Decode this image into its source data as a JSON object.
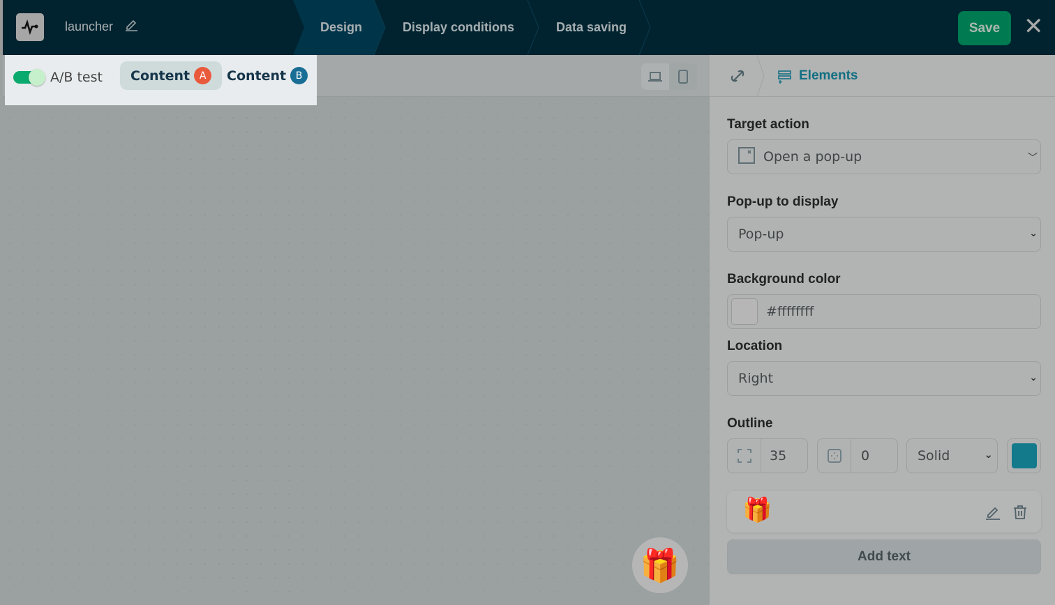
{
  "header": {
    "title": "launcher",
    "steps": [
      "Design",
      "Display conditions",
      "Data saving"
    ],
    "save_label": "Save",
    "close_label": "✕"
  },
  "abtest": {
    "label": "A/B test",
    "enabled": true,
    "tabs": [
      {
        "label": "Content",
        "badge": "A",
        "color": "#e95a3c"
      },
      {
        "label": "Content",
        "badge": "B",
        "color": "#1a6e96"
      }
    ]
  },
  "panel": {
    "breadcrumb": "Elements",
    "target_action": {
      "label": "Target action",
      "value": "Open a pop-up"
    },
    "popup": {
      "label": "Pop-up to display",
      "value": "Pop-up"
    },
    "bg": {
      "label": "Background color",
      "value": "#ffffffff"
    },
    "location": {
      "label": "Location",
      "value": "Right"
    },
    "outline": {
      "label": "Outline",
      "radius": "35",
      "width": "0",
      "style": "Solid",
      "color": "#137a8c"
    },
    "add_text": "Add text"
  }
}
